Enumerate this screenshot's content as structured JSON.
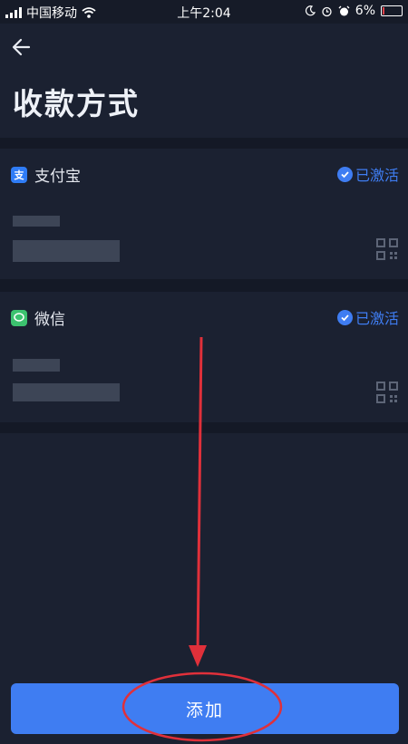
{
  "status_bar": {
    "carrier": "中国移动",
    "time": "上午2:04",
    "battery": "6%"
  },
  "header": {
    "title": "收款方式"
  },
  "payment_methods": [
    {
      "name": "支付宝",
      "icon_text": "支",
      "icon_color": "#2f7cf6",
      "status": "已激活"
    },
    {
      "name": "微信",
      "icon_color": "#3cc26f",
      "status": "已激活"
    }
  ],
  "footer": {
    "add_label": "添加"
  },
  "colors": {
    "accent": "#3f7df2",
    "background": "#1b2131",
    "annotation": "#e0303a"
  },
  "icons": [
    "back-arrow-icon",
    "wifi-icon",
    "moon-icon",
    "alarm-icon",
    "battery-icon",
    "check-circle-icon",
    "qr-code-icon",
    "wechat-icon"
  ]
}
